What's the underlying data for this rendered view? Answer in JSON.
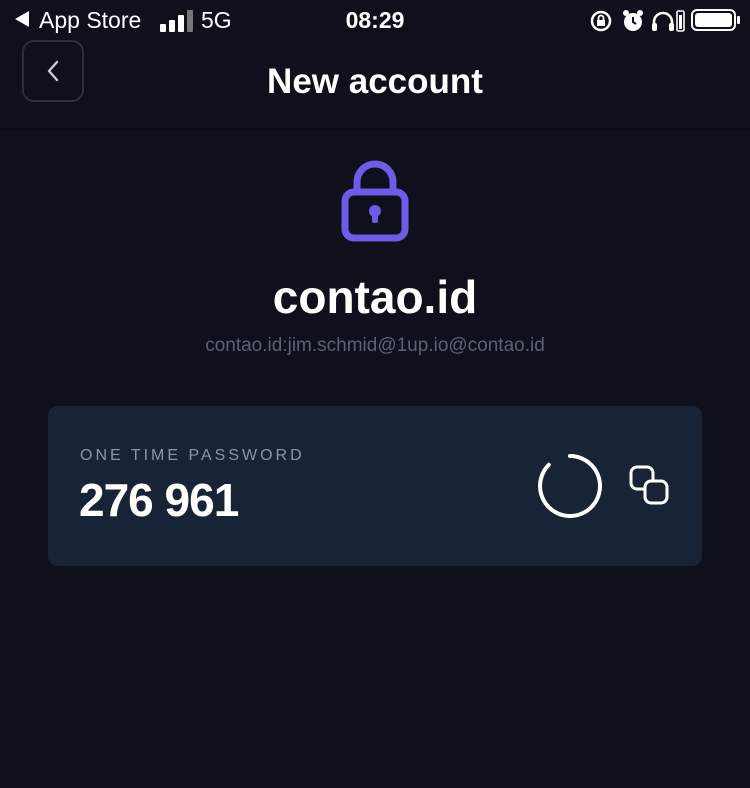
{
  "status_bar": {
    "back_app": "App Store",
    "network": "5G",
    "time": "08:29"
  },
  "header": {
    "title": "New account"
  },
  "account": {
    "name": "contao.id",
    "identifier": "contao.id:jim.schmid@1up.io@contao.id"
  },
  "otp": {
    "label": "ONE TIME PASSWORD",
    "code": "276 961"
  },
  "colors": {
    "background": "#0e111c",
    "card": "#182335",
    "accent": "#6c5ce7"
  }
}
